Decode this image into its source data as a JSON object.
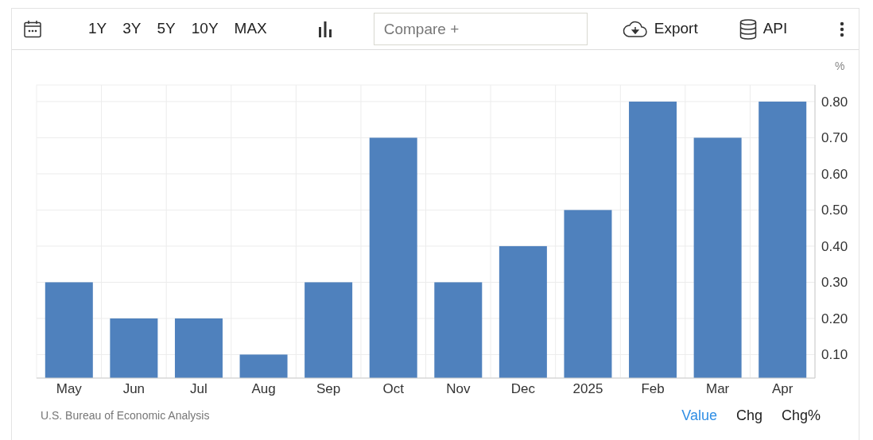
{
  "toolbar": {
    "ranges": [
      "1Y",
      "3Y",
      "5Y",
      "10Y",
      "MAX"
    ],
    "compare": {
      "placeholder": "Compare +"
    },
    "export": "Export",
    "api": "API"
  },
  "chart": {
    "unit": "%",
    "chart_data": {
      "type": "bar",
      "categories": [
        "May",
        "Jun",
        "Jul",
        "Aug",
        "Sep",
        "Oct",
        "Nov",
        "Dec",
        "2025",
        "Feb",
        "Mar",
        "Apr"
      ],
      "grid": true,
      "series": [
        {
          "color": "#4f81bd",
          "values": [
            0.3,
            0.2,
            0.2,
            0.1,
            0.3,
            0.7,
            0.3,
            0.4,
            0.5,
            0.8,
            0.7,
            0.8
          ]
        }
      ],
      "ylim": [
        0.035,
        0.846
      ],
      "yticks": [
        {
          "value": 0.1,
          "label": "0.10"
        },
        {
          "value": 0.2,
          "label": "0.20"
        },
        {
          "value": 0.3,
          "label": "0.30"
        },
        {
          "value": 0.4,
          "label": "0.40"
        },
        {
          "value": 0.5,
          "label": "0.50"
        },
        {
          "value": 0.6,
          "label": "0.60"
        },
        {
          "value": 0.7,
          "label": "0.70"
        },
        {
          "value": 0.8,
          "label": "0.80"
        }
      ]
    }
  },
  "footer": {
    "source": "U.S. Bureau of Economic Analysis",
    "modes": [
      {
        "label": "Value",
        "selected": true
      },
      {
        "label": "Chg",
        "selected": false
      },
      {
        "label": "Chg%",
        "selected": false
      }
    ]
  }
}
